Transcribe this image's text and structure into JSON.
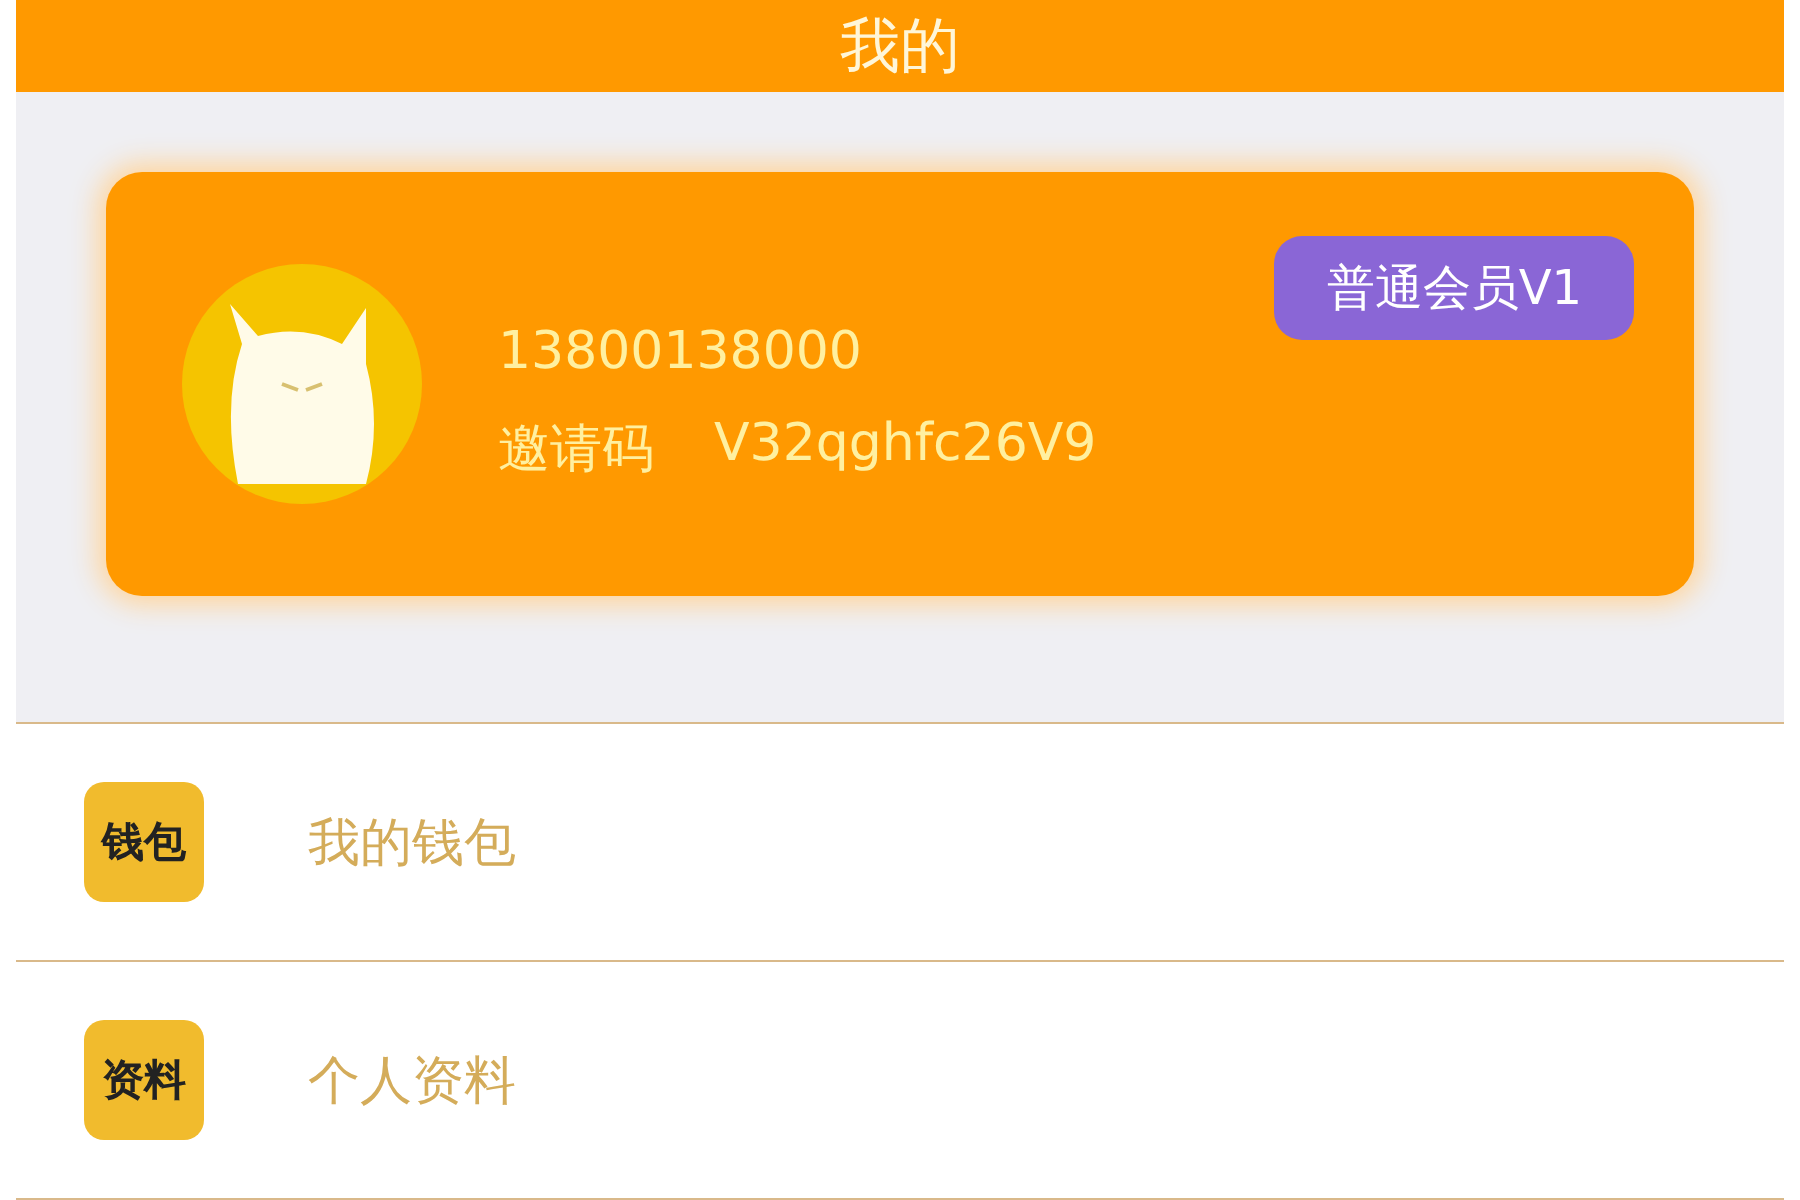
{
  "header": {
    "title": "我的"
  },
  "profile": {
    "phone": "13800138000",
    "invite_label": "邀请码",
    "invite_code": "V32qghfc26V9",
    "badge": "普通会员V1"
  },
  "menu": [
    {
      "icon_text": "钱包",
      "label": "我的钱包"
    },
    {
      "icon_text": "资料",
      "label": "个人资料"
    }
  ]
}
